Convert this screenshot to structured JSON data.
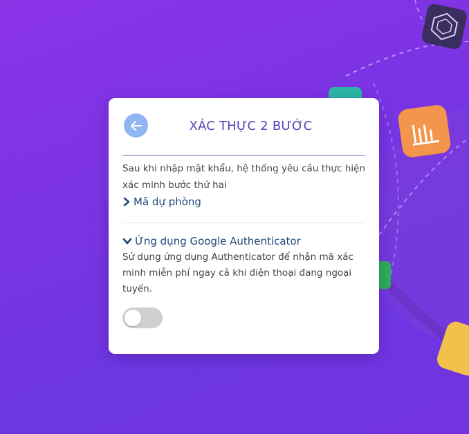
{
  "page": {
    "title": "XÁC THỰC 2 BƯỚC",
    "description": "Sau khi nhập mật khẩu, hệ thống yêu cầu thực hiện xác minh bước thứ hai",
    "back_icon": "arrow-left-icon"
  },
  "backup_code": {
    "label": "Mã dự phòng",
    "icon": "chevron-right-icon"
  },
  "authenticator": {
    "label": "Ứng dụng Google Authenticator",
    "icon": "chevron-down-icon",
    "description": "Sử dụng ứng dụng Authenticator để nhận mã xác minh miễn phí ngay cả khi điện thoại đang ngoại tuyến.",
    "enabled": false
  },
  "colors": {
    "accent": "#5a3fb8",
    "link": "#23487d",
    "back_button": "#8fb6f2",
    "toggle_off": "#cfcfcf"
  }
}
